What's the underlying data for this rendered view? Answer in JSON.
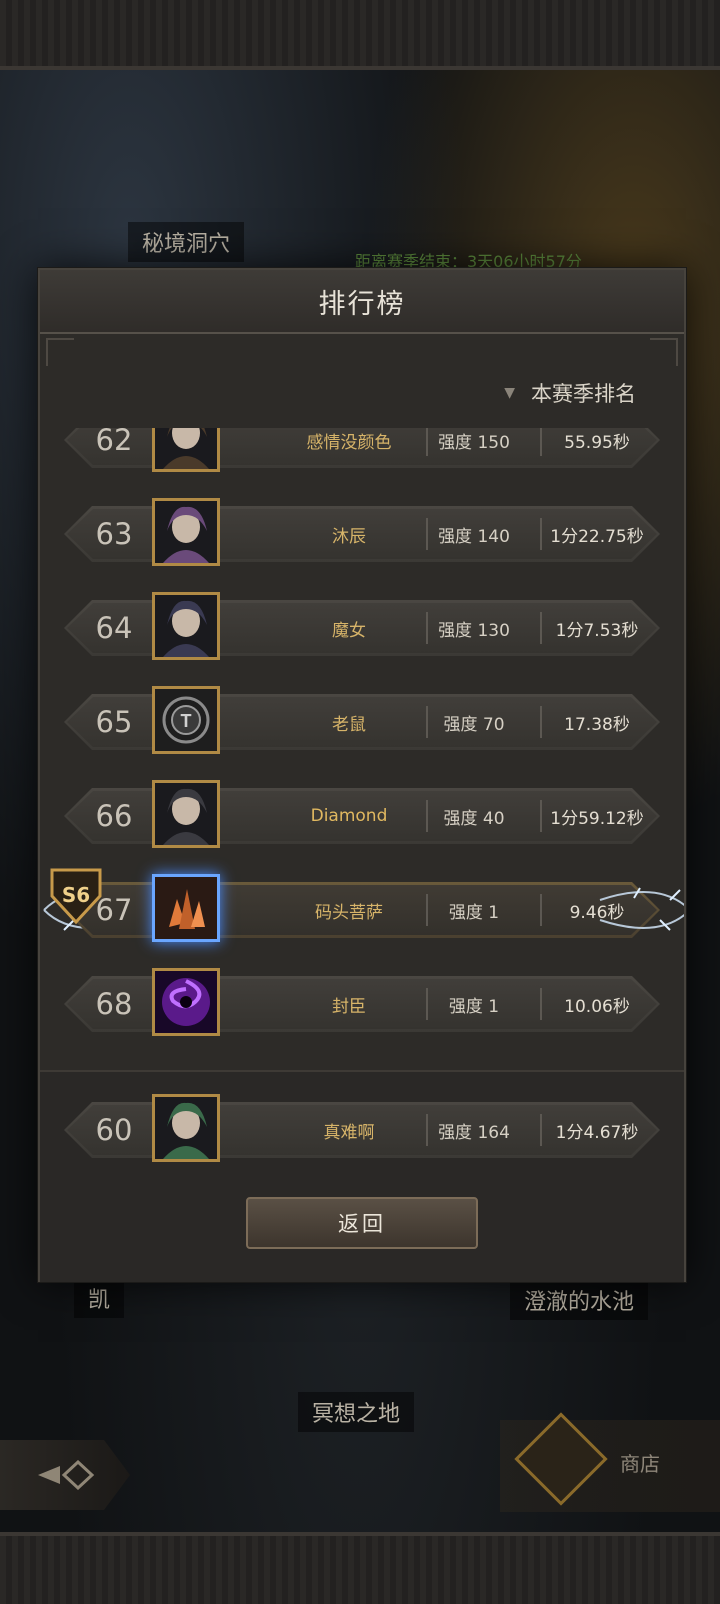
{
  "background": {
    "map_labels": [
      "秘境洞穴",
      "凯",
      "澄澈的水池",
      "冥想之地"
    ],
    "timer_text": "距离赛季结束：3天06小时57分",
    "shop_label": "商店"
  },
  "modal": {
    "title": "排行榜",
    "sort_label": "本赛季排名",
    "return_label": "返回"
  },
  "rows": [
    {
      "rank": "62",
      "name": "感情没颜色",
      "power": "强度 150",
      "time": "55.95秒",
      "avatar": "hooded-warrior",
      "avatar_color": "#4a3a2a",
      "name_color": "#d7b469"
    },
    {
      "rank": "63",
      "name": "沐辰",
      "power": "强度 140",
      "time": "1分22.75秒",
      "avatar": "purple-sorceress",
      "avatar_color": "#6a4a7a",
      "name_color": "#d7b469"
    },
    {
      "rank": "64",
      "name": "魔女",
      "power": "强度 130",
      "time": "1分7.53秒",
      "avatar": "witch",
      "avatar_color": "#3a3a52",
      "name_color": "#d7b469"
    },
    {
      "rank": "65",
      "name": "老鼠",
      "power": "强度 70",
      "time": "17.38秒",
      "avatar": "default-emblem",
      "avatar_color": "#2a2a2a",
      "name_color": "#d7b469"
    },
    {
      "rank": "66",
      "name": "Diamond",
      "power": "强度 40",
      "time": "1分59.12秒",
      "avatar": "elf-maiden",
      "avatar_color": "#3a3a40",
      "name_color": "#e0b860"
    },
    {
      "rank": "67",
      "name": "码头菩萨",
      "power": "强度 1",
      "time": "9.46秒",
      "avatar": "crystal-shard",
      "avatar_color": "#c0602a",
      "name_color": "#d7b469",
      "highlight": true,
      "season_badge": "S6"
    },
    {
      "rank": "68",
      "name": "封臣",
      "power": "强度 1",
      "time": "10.06秒",
      "avatar": "purple-vortex",
      "avatar_color": "#5a1a8a",
      "name_color": "#d7b469"
    }
  ],
  "self_row": {
    "rank": "60",
    "name": "真难啊",
    "power": "强度 164",
    "time": "1分4.67秒",
    "avatar": "green-dryad",
    "avatar_color": "#3a6a4a",
    "name_color": "#d7b469"
  },
  "colors": {
    "accent_gold": "#b08a45",
    "highlight_blue": "#6aa6ff"
  }
}
